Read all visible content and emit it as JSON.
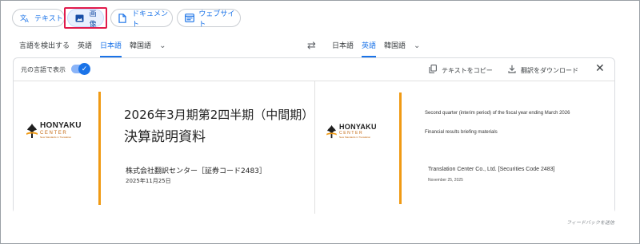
{
  "modes": {
    "text_label": "テキスト",
    "image_label": "画像",
    "document_label": "ドキュメント",
    "website_label": "ウェブサイト"
  },
  "source_langs": {
    "detect_label": "言語を検出する",
    "items": [
      "英語",
      "日本語",
      "韓国語"
    ],
    "active": "日本語"
  },
  "target_langs": {
    "items": [
      "日本語",
      "英語",
      "韓国語"
    ],
    "active": "英語"
  },
  "panel": {
    "show_original_label": "元の言語で表示",
    "show_original_on": true,
    "copy_text_label": "テキストをコピー",
    "download_label": "翻訳をダウンロード"
  },
  "logo": {
    "main": "HONYAKU",
    "sub": "CENTER",
    "tagline": "New Standards in Translation"
  },
  "original_doc": {
    "title_line1": "2026年3月期第2四半期（中間期）",
    "title_line2": "決算説明資料",
    "company": "株式会社翻訳センター［証券コード2483］",
    "date": "2025年11月25日"
  },
  "translated_doc": {
    "title_line1": "Second quarter (interim period) of the fiscal year ending March 2026",
    "title_line2": "Financial results briefing materials",
    "company": "Translation Center Co., Ltd. [Securities Code 2483]",
    "date": "November 25, 2025"
  },
  "feedback_label": "フィードバックを送信",
  "colors": {
    "accent": "#1a73e8",
    "highlight": "#e11b4c",
    "doc_orange": "#f09a14"
  }
}
